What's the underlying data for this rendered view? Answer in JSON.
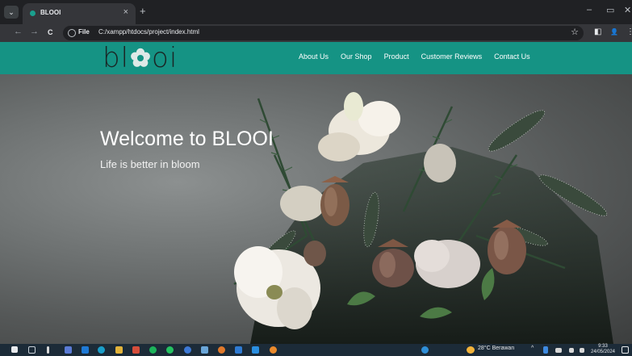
{
  "browser": {
    "tab_title": "BLOOI",
    "tab_close": "×",
    "new_tab": "+",
    "tab_menu": "⌄",
    "minimize": "–",
    "maximize": "▭",
    "close": "✕",
    "back": "←",
    "forward": "→",
    "reload": "C",
    "file_chip": "File",
    "url": "C:/xampp/htdocs/project/index.html",
    "bookmark": "☆",
    "sidebar_toggle": "◧",
    "profile": "👤",
    "menu": "⋮"
  },
  "site": {
    "logo_left": "bl",
    "logo_right": "oi",
    "brand_color": "#159384",
    "nav": [
      "About Us",
      "Our Shop",
      "Product",
      "Customer Reviews",
      "Contact Us"
    ],
    "hero_title": "Welcome to BLOOI",
    "hero_subtitle": "Life is better in bloom"
  },
  "taskbar": {
    "weather": "28°C  Berawan",
    "tray_up": "^",
    "time": "9:33",
    "date": "24/05/2024"
  }
}
